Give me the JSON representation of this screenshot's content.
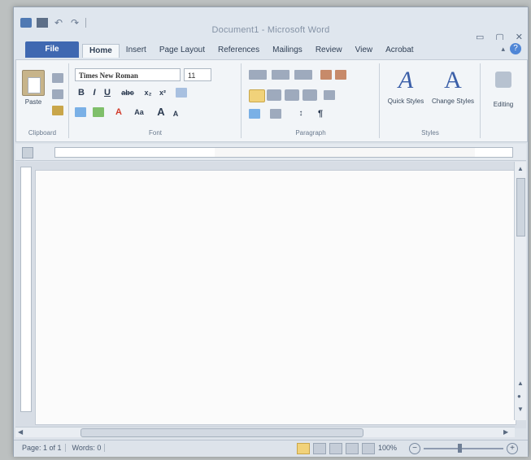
{
  "window": {
    "title": "Document1 - Microsoft Word"
  },
  "quick_access": {
    "undo": "↶",
    "redo": "↷"
  },
  "window_controls": {
    "minimize": "▭",
    "maximize": "▢",
    "close": "✕"
  },
  "tabs": {
    "file": "File",
    "items": [
      "Home",
      "Insert",
      "Page Layout",
      "References",
      "Mailings",
      "Review",
      "View",
      "Acrobat"
    ]
  },
  "ribbon": {
    "clipboard": {
      "label": "Clipboard",
      "paste": "Paste"
    },
    "font": {
      "label": "Font",
      "name": "Times New Roman",
      "size": "11",
      "bold": "B",
      "italic": "I",
      "underline": "U",
      "strike": "abc",
      "sub": "x₂",
      "sup": "x²",
      "grow": "A",
      "shrink": "A",
      "color": "A",
      "case": "Aa"
    },
    "paragraph": {
      "label": "Paragraph",
      "marks": "¶",
      "sort": "↕"
    },
    "styles": {
      "label": "Styles",
      "quick": "Quick Styles",
      "change": "Change Styles"
    },
    "editing": {
      "label": "Editing"
    }
  },
  "status": {
    "page": "Page: 1 of 1",
    "words": "Words: 0",
    "zoom": "100%",
    "minus": "−",
    "plus": "+"
  },
  "colors": {
    "file_tab": "#3f68b1",
    "accent": "#3b5fa8",
    "highlight": "#f1d27a"
  }
}
